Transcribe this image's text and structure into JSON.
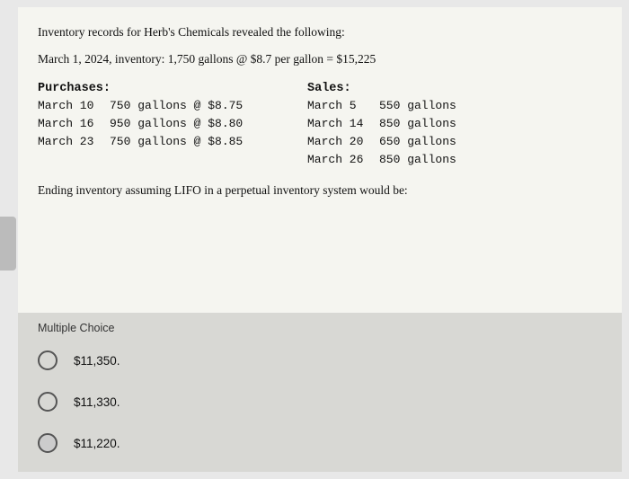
{
  "intro": {
    "text": "Inventory records for Herb's Chemicals revealed the following:"
  },
  "opening": {
    "text": "March 1, 2024, inventory: 1,750 gallons @ $8.7 per gallon = $15,225"
  },
  "purchases": {
    "header": "Purchases:",
    "rows": [
      {
        "date": "March 10",
        "detail": "750 gallons @ $8.75"
      },
      {
        "date": "March 16",
        "detail": "950 gallons @ $8.80"
      },
      {
        "date": "March 23",
        "detail": "750 gallons @ $8.85"
      }
    ]
  },
  "sales": {
    "header": "Sales:",
    "rows": [
      {
        "date": "March 5",
        "detail": "550 gallons"
      },
      {
        "date": "March 14",
        "detail": "850 gallons"
      },
      {
        "date": "March 20",
        "detail": "650 gallons"
      },
      {
        "date": "March 26",
        "detail": "850 gallons"
      }
    ]
  },
  "ending": {
    "text": "Ending inventory assuming LIFO in a perpetual inventory system would be:"
  },
  "multiple_choice": {
    "label": "Multiple Choice",
    "options": [
      {
        "value": "$11,350.",
        "id": "opt1"
      },
      {
        "value": "$11,330.",
        "id": "opt2"
      },
      {
        "value": "$11,220.",
        "id": "opt3"
      }
    ]
  }
}
